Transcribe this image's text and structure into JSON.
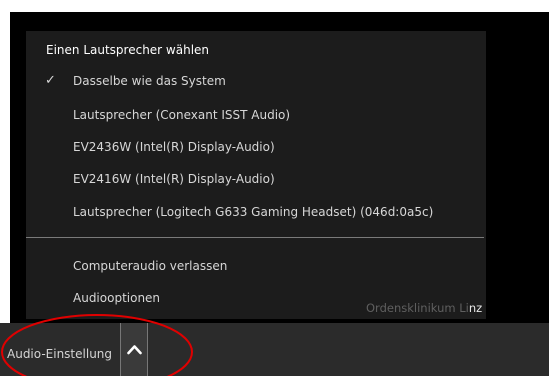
{
  "speaker_menu": {
    "heading": "Einen Lautsprecher wählen",
    "items": [
      {
        "label": "Dasselbe wie das System",
        "checked": true,
        "check_glyph": "✓"
      },
      {
        "label": "Lautsprecher (Conexant ISST Audio)",
        "checked": false,
        "check_glyph": ""
      },
      {
        "label": "EV2436W (Intel(R) Display-Audio)",
        "checked": false,
        "check_glyph": ""
      },
      {
        "label": "EV2416W (Intel(R) Display-Audio)",
        "checked": false,
        "check_glyph": ""
      },
      {
        "label": "Lautsprecher (Logitech G633 Gaming Headset) (046d:0a5c)",
        "checked": false,
        "check_glyph": ""
      }
    ],
    "actions": [
      {
        "label": "Computeraudio verlassen"
      },
      {
        "label": "Audiooptionen"
      }
    ]
  },
  "watermark": {
    "dim_text": "Ordensklinikum Li",
    "bright_text": "nz"
  },
  "toolbar": {
    "audio_settings_label": "Audio-Einstellung",
    "collapse_icon": "chevron-up-icon"
  },
  "colors": {
    "menu_background": "#1c1c1c",
    "toolbar_background": "#2b2b2b",
    "annotation_ellipse": "#e00000"
  }
}
